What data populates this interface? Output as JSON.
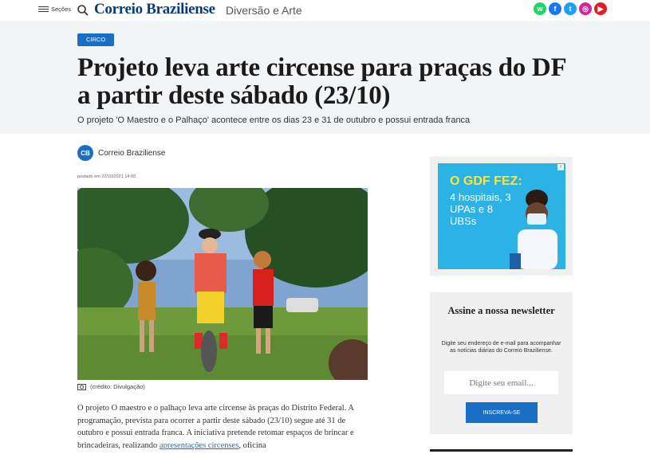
{
  "header": {
    "menu_label": "Seções",
    "logo": "Correio Braziliense",
    "section": "Diversão e Arte",
    "social": [
      {
        "name": "whatsapp",
        "color": "#25d366",
        "glyph": "w"
      },
      {
        "name": "facebook",
        "color": "#1877f2",
        "glyph": "f"
      },
      {
        "name": "twitter",
        "color": "#1da1f2",
        "glyph": "t"
      },
      {
        "name": "instagram",
        "color": "#d6249f",
        "glyph": "◎"
      },
      {
        "name": "youtube",
        "color": "#e02020",
        "glyph": "▶"
      }
    ]
  },
  "article": {
    "tag": "CIRCO",
    "headline": "Projeto leva arte circense para praças do DF a partir deste sábado (23/10)",
    "subhead": "O projeto 'O Maestro e o Palhaço' acontece entre os dias 23 e 31 de outubro e possui entrada franca",
    "author_initials": "CB",
    "author": "Correio Braziliense",
    "posted": "postado em 22/10/2021 14:00",
    "photo_credit": "(crédito: Divulgação)",
    "body_before_link": "O projeto O maestro e o palhaço leva arte circense às praças do Distrito Federal. A programação, prevista para ocorrer a partir deste sábado (23/10) segue até 31 de outubro e possui entrada franca. A iniciativa pretende retomar espaços de brincar e brincadeiras, realizando ",
    "body_link": "apresentações circenses",
    "body_after_link": ", oficina"
  },
  "ad": {
    "title": "O GDF FEZ:",
    "body": "4 hospitais, 3 UPAs e 8 UBSs",
    "close": "x"
  },
  "newsletter": {
    "title": "Assine a nossa newsletter",
    "description": "Digite seu endereço de e-mail para acompanhar as notícias diárias do Correio Braziliense.",
    "placeholder": "Digite seu email...",
    "button": "INSCREVA-SE"
  },
  "colors": {
    "brand_blue": "#1a6fc4",
    "logo_navy": "#0d3a7a",
    "ad_bg": "#2bb3e6",
    "ad_title": "#ffe23a"
  }
}
